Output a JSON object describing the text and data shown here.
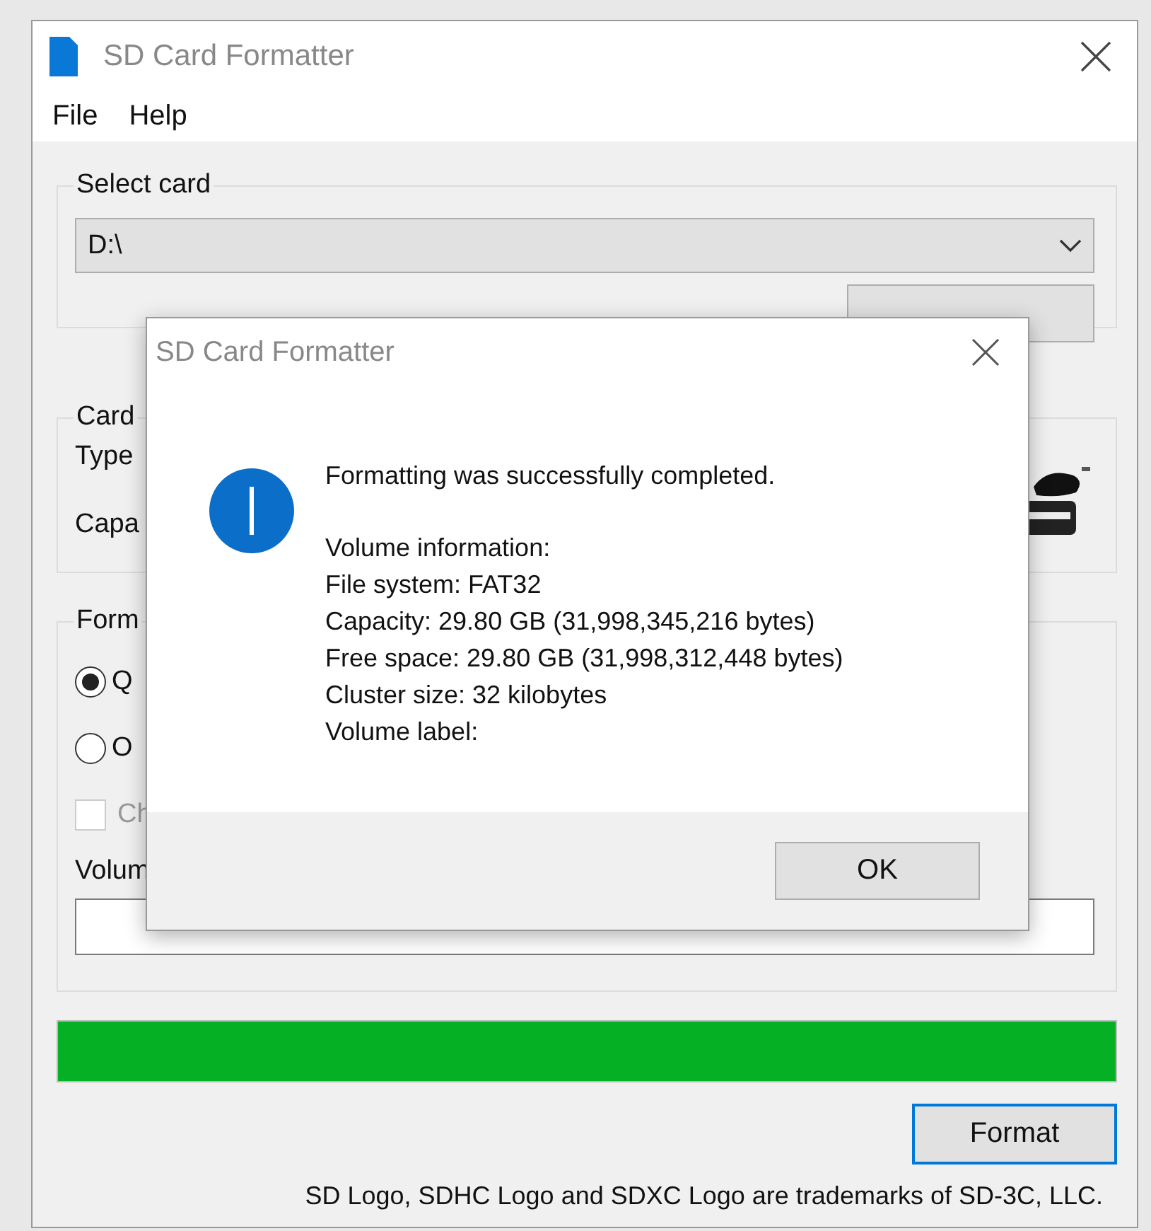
{
  "main_window": {
    "title": "SD Card Formatter",
    "menu": [
      "File",
      "Help"
    ],
    "select_card": {
      "label": "Select card",
      "drive": "D:\\"
    },
    "card_info": {
      "label": "Card",
      "type_label": "Type",
      "capacity_label": "Capa"
    },
    "formatting": {
      "label": "Form",
      "options": [
        {
          "label": "Q",
          "selected": true
        },
        {
          "label": "O",
          "selected": false
        }
      ],
      "checkbox": {
        "label": "Ch",
        "checked": false,
        "disabled": true
      },
      "volume_label": "Volum"
    },
    "progress": {
      "level": 1
    },
    "format_button": "Format",
    "trademark": "SD Logo, SDHC Logo and SDXC Logo are trademarks of SD-3C, LLC."
  },
  "dialog": {
    "title": "SD Card Formatter",
    "message": "Formatting was successfully completed.",
    "details": [
      "Volume information:",
      "File system: FAT32",
      "Capacity: 29.80 GB (31,998,345,216 bytes)",
      "Free space: 29.80 GB (31,998,312,448 bytes)",
      "Cluster size: 32 kilobytes",
      "Volume label:"
    ],
    "ok_button": "OK"
  }
}
